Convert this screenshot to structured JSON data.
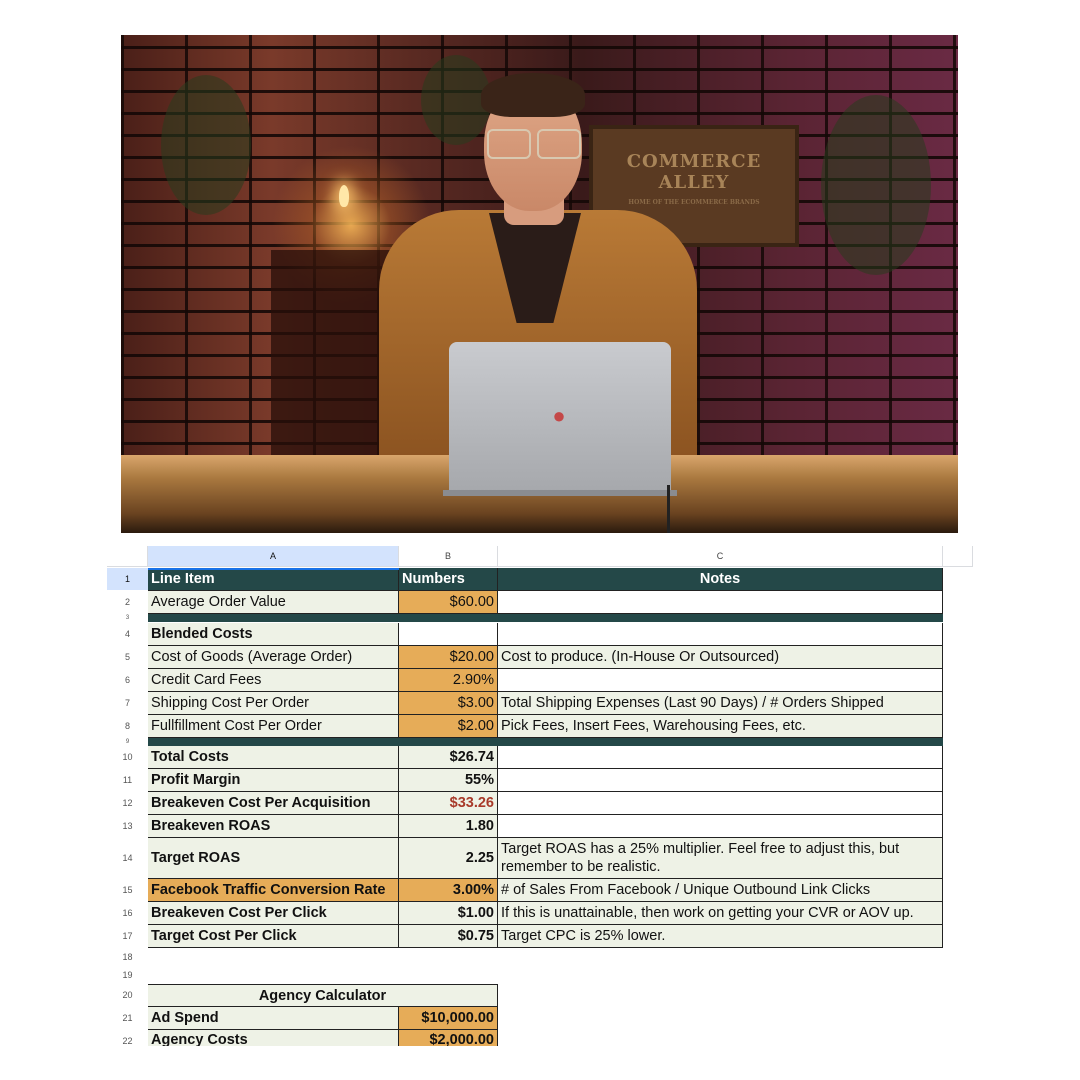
{
  "video": {
    "sign_line1": "COMMERCE",
    "sign_line2": "ALLEY",
    "sign_line3": "HOME OF THE ECOMMERCE BRANDS"
  },
  "sheet": {
    "columns": [
      "A",
      "B",
      "C"
    ],
    "header": {
      "a": "Line Item",
      "b": "Numbers",
      "c": "Notes"
    },
    "row_numbers": [
      "1",
      "2",
      "3",
      "4",
      "5",
      "6",
      "7",
      "8",
      "9",
      "10",
      "11",
      "12",
      "13",
      "14",
      "15",
      "16",
      "17",
      "18",
      "19",
      "20",
      "21",
      "22"
    ],
    "average_order_value": {
      "label": "Average Order Value",
      "value": "$60.00"
    },
    "blended_costs": "Blended Costs",
    "cost_of_goods": {
      "label": "Cost of Goods (Average Order)",
      "value": "$20.00",
      "note": "Cost to produce. (In-House Or Outsourced)"
    },
    "credit_card_fees": {
      "label": "Credit Card Fees",
      "value": "2.90%"
    },
    "shipping_cost": {
      "label": "Shipping Cost Per Order",
      "value": "$3.00",
      "note": "Total Shipping Expenses (Last 90 Days) / # Orders Shipped"
    },
    "fulfillment_cost": {
      "label": "Fullfillment Cost Per Order",
      "value": "$2.00",
      "note": "Pick Fees, Insert Fees, Warehousing Fees, etc."
    },
    "total_costs": {
      "label": "Total Costs",
      "value": "$26.74"
    },
    "profit_margin": {
      "label": "Profit Margin",
      "value": "55%"
    },
    "breakeven_cpa": {
      "label": "Breakeven Cost Per Acquisition",
      "value": "$33.26"
    },
    "breakeven_roas": {
      "label": "Breakeven ROAS",
      "value": "1.80"
    },
    "target_roas": {
      "label": "Target ROAS",
      "value": "2.25",
      "note": "Target ROAS has a 25% multiplier. Feel free to adjust this, but remember to be realistic."
    },
    "fb_conversion": {
      "label": "Facebook Traffic Conversion Rate",
      "value": "3.00%",
      "note": "# of Sales From Facebook / Unique Outbound Link Clicks"
    },
    "breakeven_cpc": {
      "label": "Breakeven Cost Per Click",
      "value": "$1.00",
      "note": "If this is unattainable, then work on getting your CVR or AOV up."
    },
    "target_cpc": {
      "label": "Target Cost Per Click",
      "value": "$0.75",
      "note": "Target CPC is 25% lower."
    },
    "agency_calculator": "Agency Calculator",
    "ad_spend": {
      "label": "Ad Spend",
      "value": "$10,000.00"
    },
    "agency_costs": {
      "label": "Agency Costs",
      "value": "$2,000.00"
    }
  }
}
